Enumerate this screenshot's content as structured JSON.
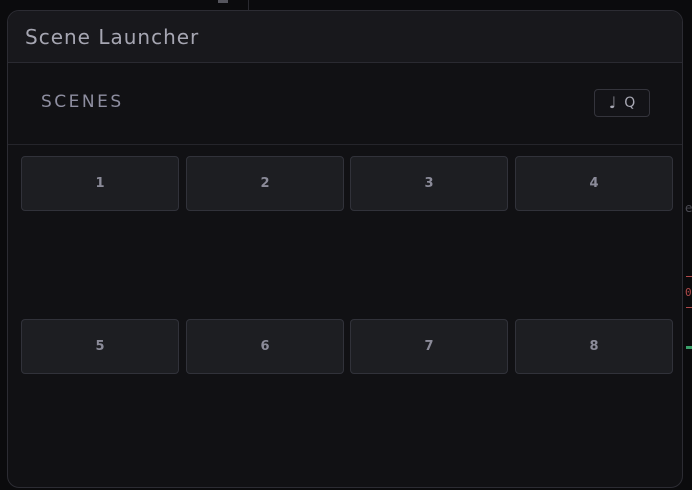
{
  "window": {
    "title": "Scene Launcher"
  },
  "scenes_section": {
    "label": "SCENES",
    "quantize_button": {
      "note_glyph": "♩",
      "label": "Q"
    }
  },
  "scenes": [
    {
      "label": "1"
    },
    {
      "label": "2"
    },
    {
      "label": "3"
    },
    {
      "label": "4"
    },
    {
      "label": "5"
    },
    {
      "label": "6"
    },
    {
      "label": "7"
    },
    {
      "label": "8"
    }
  ],
  "background_fragments": {
    "edge_letter": "e",
    "edge_digit": "0"
  },
  "colors": {
    "panel_bg": "#111114",
    "titlebar_bg": "#18181c",
    "button_bg": "#1d1e22",
    "button_border": "#31323a",
    "text_muted": "#8b8b99",
    "accent_red": "#b04a4a",
    "accent_green": "#3aa06a"
  }
}
